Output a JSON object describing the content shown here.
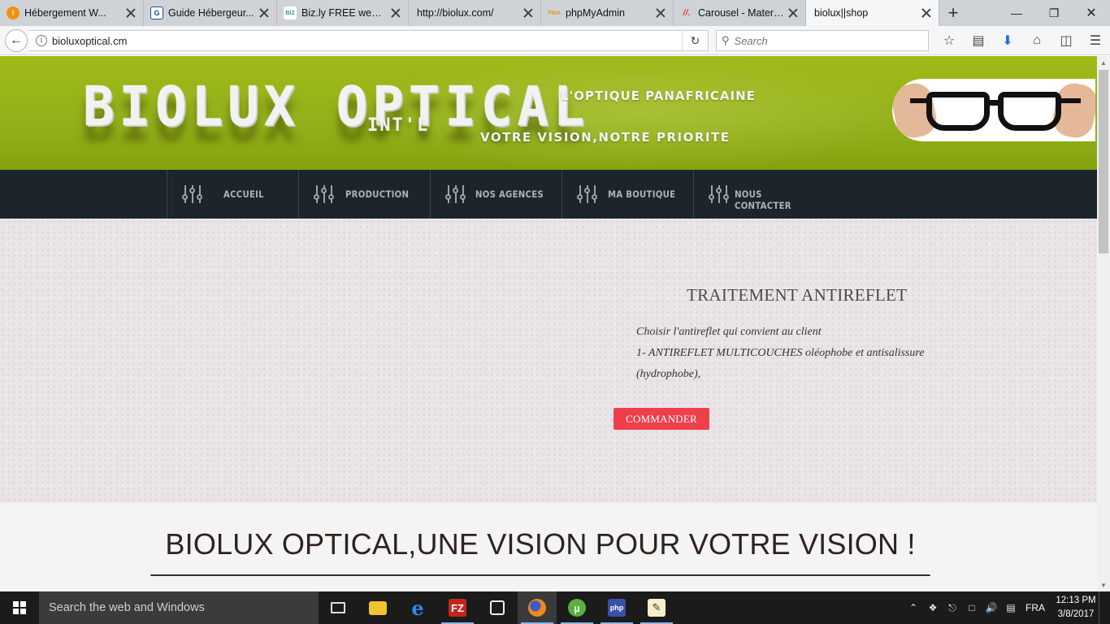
{
  "browser": {
    "tabs": [
      {
        "title": "Hébergement W...",
        "favicon_color": "#f29111",
        "favicon_glyph": "!"
      },
      {
        "title": "Guide Hébergeur...",
        "favicon_color": "#1a4fa0",
        "favicon_glyph": "G"
      },
      {
        "title": "Biz.ly FREE web h...",
        "favicon_color": "#2e9c8e",
        "favicon_glyph": "BIZ"
      },
      {
        "title": "http://biolux.com/",
        "favicon_color": "",
        "favicon_glyph": ""
      },
      {
        "title": "phpMyAdmin",
        "favicon_color": "#e39b2c",
        "favicon_glyph": "PMA"
      },
      {
        "title": "Carousel - Materi...",
        "favicon_color": "#e5484d",
        "favicon_glyph": "//."
      },
      {
        "title": "biolux||shop",
        "favicon_color": "",
        "favicon_glyph": ""
      }
    ],
    "active_tab_index": 6,
    "url": "bioluxoptical.cm",
    "search_placeholder": "Search"
  },
  "site": {
    "logo_text": "BIOLUX OPTICAL",
    "logo_suffix": "INT'L",
    "slogan_top": "L'OPTIQUE PANAFRICAINE",
    "slogan_bottom": "VOTRE VISION,NOTRE PRIORITE",
    "banner_color": "#97b41a",
    "menu": [
      {
        "label": "ACCUEIL",
        "icon": "sliders-icon"
      },
      {
        "label": "PRODUCTION",
        "icon": "sliders-icon"
      },
      {
        "label": "NOS AGENCES",
        "icon": "sliders-icon"
      },
      {
        "label": "MA BOUTIQUE",
        "icon": "sliders-icon"
      },
      {
        "label": "NOUS CONTACTER",
        "icon": "sliders-icon"
      }
    ],
    "hero": {
      "title": "TRAITEMENT ANTIREFLET",
      "lines": [
        "Choisir l'antireflet qui convient au client",
        "1- ANTIREFLET MULTICOUCHES oléophobe et antisalissure",
        "(hydrophobe),"
      ],
      "button_label": "COMMANDER",
      "button_color": "#ee3f4b"
    },
    "section_title": "BIOLUX OPTICAL,UNE VISION POUR VOTRE VISION !"
  },
  "taskbar": {
    "search_placeholder": "Search the web and Windows",
    "language": "FRA",
    "time": "12:13 PM",
    "date": "3/8/2017"
  }
}
